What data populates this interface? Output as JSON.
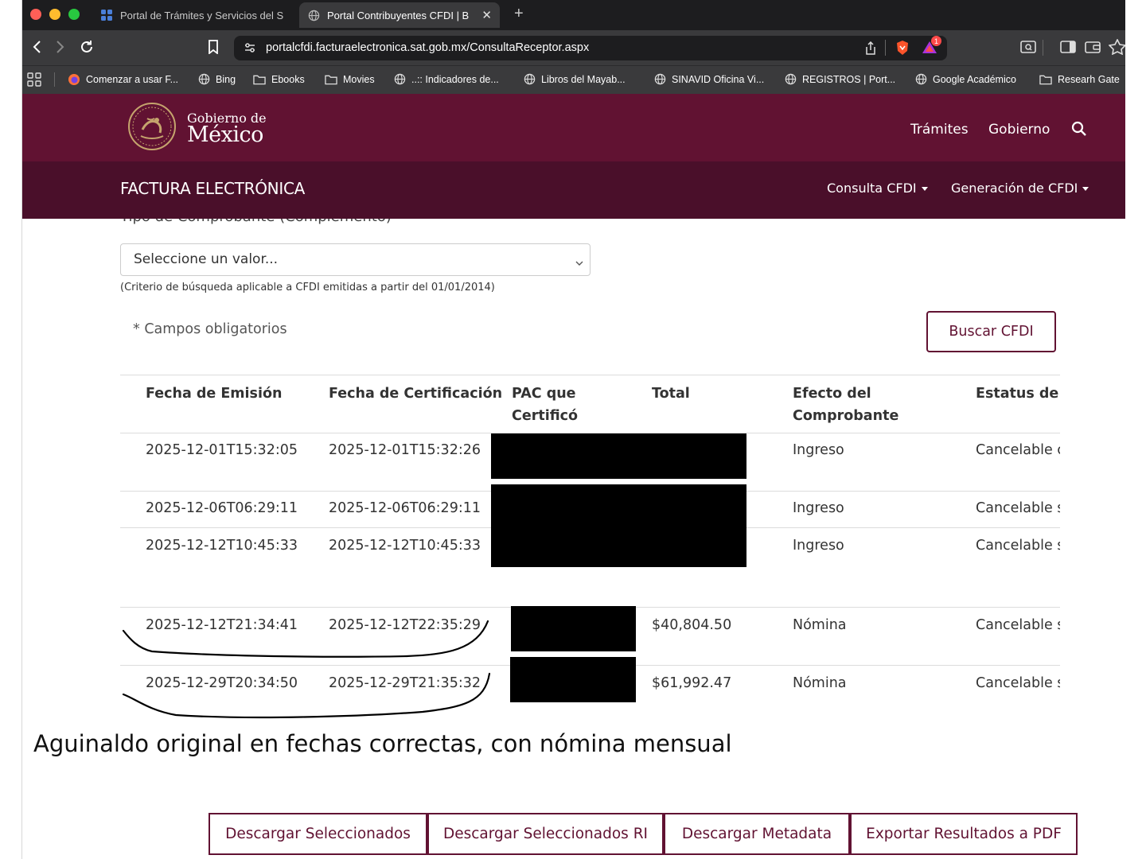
{
  "browser": {
    "tabs": [
      {
        "title": "Portal de Trámites y Servicios del S",
        "active": false,
        "icon": "multi-square-icon"
      },
      {
        "title": "Portal Contribuyentes CFDI | B",
        "active": true,
        "icon": "globe-icon"
      }
    ],
    "close_tab": "✕",
    "new_tab": "+",
    "url": "portalcfdi.facturaelectronica.sat.gob.mx/ConsultaReceptor.aspx",
    "notification_count": "1",
    "bookmarks": [
      {
        "label": "Comenzar a usar F...",
        "icon": "firefox-icon"
      },
      {
        "label": "Bing",
        "icon": "globe-icon"
      },
      {
        "label": "Ebooks",
        "icon": "folder-icon"
      },
      {
        "label": "Movies",
        "icon": "folder-icon"
      },
      {
        "label": "..:: Indicadores de...",
        "icon": "globe-icon"
      },
      {
        "label": "Libros del Mayab...",
        "icon": "globe-icon"
      },
      {
        "label": "SINAVID Oficina Vi...",
        "icon": "globe-icon"
      },
      {
        "label": "REGISTROS | Port...",
        "icon": "globe-icon"
      },
      {
        "label": "Google Académico",
        "icon": "globe-icon"
      },
      {
        "label": "Researh Gate",
        "icon": "folder-icon"
      }
    ]
  },
  "site": {
    "logo_line1": "Gobierno de",
    "logo_line2": "México",
    "nav": [
      "Trámites",
      "Gobierno"
    ],
    "brand": "FACTURA ELECTRÓNICA",
    "subnav": [
      "Consulta CFDI",
      "Generación de CFDI"
    ],
    "colors": {
      "primary": "#611232",
      "secondary": "#4a0f2a"
    }
  },
  "form": {
    "clipped_label": "Tipo de Comprobante (Complemento)",
    "select_value": "Seleccione un valor...",
    "hint": "(Criterio de búsqueda aplicable a CFDI emitidas a partir del 01/01/2014)",
    "required_note": "* Campos obligatorios",
    "search_button": "Buscar CFDI"
  },
  "table": {
    "headers": [
      {
        "line1": "Fecha de Emisión",
        "line2": ""
      },
      {
        "line1": "Fecha de Certificación",
        "line2": ""
      },
      {
        "line1": "PAC que",
        "line2": "Certificó"
      },
      {
        "line1": "Total",
        "line2": ""
      },
      {
        "line1": "Efecto del",
        "line2": "Comprobante"
      },
      {
        "line1": "Estatus de c",
        "line2": ""
      }
    ],
    "rows": [
      {
        "emision": "2025-12-01T15:32:05",
        "certificacion": "2025-12-01T15:32:26",
        "total": "",
        "efecto": "Ingreso",
        "estatus": "Cancelable c"
      },
      {
        "emision": "2025-12-06T06:29:11",
        "certificacion": "2025-12-06T06:29:11",
        "total": "",
        "efecto": "Ingreso",
        "estatus": "Cancelable s"
      },
      {
        "emision": "2025-12-12T10:45:33",
        "certificacion": "2025-12-12T10:45:33",
        "total": "",
        "efecto": "Ingreso",
        "estatus": "Cancelable s"
      },
      {
        "emision": "2025-12-12T21:34:41",
        "certificacion": "2025-12-12T22:35:29",
        "total": "$40,804.50",
        "efecto": "Nómina",
        "estatus": "Cancelable s"
      },
      {
        "emision": "2025-12-29T20:34:50",
        "certificacion": "2025-12-29T21:35:32",
        "total": "$61,992.47",
        "efecto": "Nómina",
        "estatus": "Cancelable s"
      }
    ]
  },
  "annotation": "Aguinaldo original en fechas correctas, con nómina mensual",
  "actions": [
    "Descargar Seleccionados",
    "Descargar Seleccionados RI",
    "Descargar Metadata",
    "Exportar Resultados a PDF"
  ]
}
